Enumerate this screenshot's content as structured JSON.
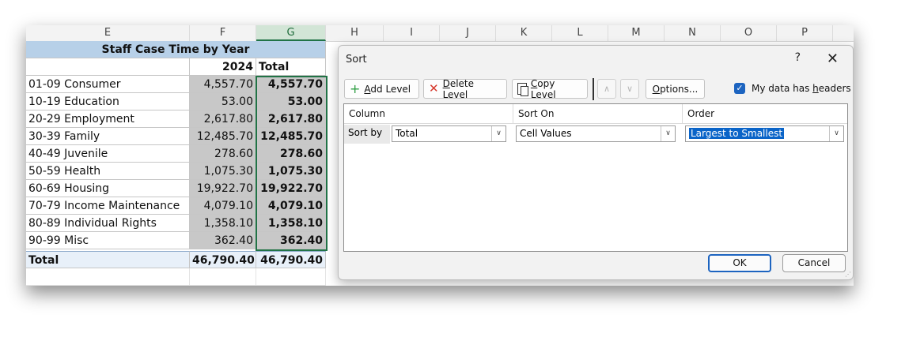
{
  "columns": [
    "E",
    "F",
    "G",
    "H",
    "I",
    "J",
    "K",
    "L",
    "M",
    "N",
    "O",
    "P"
  ],
  "table": {
    "title": "Staff Case Time by Year",
    "header_year": "2024",
    "header_total": "Total",
    "rows": [
      {
        "label": "01-09 Consumer",
        "year": "4,557.70",
        "total": "4,557.70"
      },
      {
        "label": "10-19 Education",
        "year": "53.00",
        "total": "53.00"
      },
      {
        "label": "20-29 Employment",
        "year": "2,617.80",
        "total": "2,617.80"
      },
      {
        "label": "30-39 Family",
        "year": "12,485.70",
        "total": "12,485.70"
      },
      {
        "label": "40-49 Juvenile",
        "year": "278.60",
        "total": "278.60"
      },
      {
        "label": "50-59 Health",
        "year": "1,075.30",
        "total": "1,075.30"
      },
      {
        "label": "60-69 Housing",
        "year": "19,922.70",
        "total": "19,922.70"
      },
      {
        "label": "70-79 Income Maintenance",
        "year": "4,079.10",
        "total": "4,079.10"
      },
      {
        "label": "80-89 Individual Rights",
        "year": "1,358.10",
        "total": "1,358.10"
      },
      {
        "label": "90-99 Misc",
        "year": "362.40",
        "total": "362.40"
      }
    ],
    "total_row": {
      "label": "Total",
      "year": "46,790.40",
      "total": "46,790.40"
    }
  },
  "dialog": {
    "title": "Sort",
    "help": "?",
    "close": "✕",
    "toolbar": {
      "add_level": {
        "pre": "",
        "u": "A",
        "post": "dd Level"
      },
      "delete_level": {
        "pre": "",
        "u": "D",
        "post": "elete Level"
      },
      "copy_level": {
        "pre": "",
        "u": "C",
        "post": "opy Level"
      },
      "options": {
        "pre": "",
        "u": "O",
        "post": "ptions..."
      },
      "headers_check": {
        "pre": "My data has ",
        "u": "h",
        "post": "eaders"
      }
    },
    "headers_checked": true,
    "pane": {
      "col_header": "Column",
      "sorton_header": "Sort On",
      "order_header": "Order",
      "sort_by_label": "Sort by",
      "column_value": "Total",
      "sort_on_value": "Cell Values",
      "order_value": "Largest to Smallest"
    },
    "ok": "OK",
    "cancel": "Cancel"
  },
  "colors": {
    "accent": "#217346",
    "title_fill": "#b7d0e8",
    "check": "#1d64c0"
  }
}
